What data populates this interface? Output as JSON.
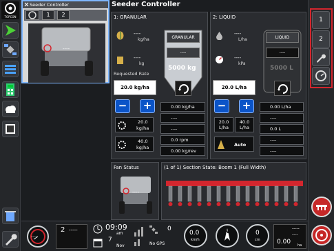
{
  "header": {
    "title": "Seeder Controller",
    "brand": "TOPCON"
  },
  "mini_view": {
    "title": "Seeder Controller",
    "tab_1": "1",
    "tab_2": "2",
    "machine_value": "----"
  },
  "granular": {
    "title": "1: GRANULAR",
    "rate_value": "----",
    "rate_unit": "kg/ha",
    "weight_value": "----",
    "weight_unit": "kg",
    "requested_label": "Requested Rate",
    "requested_rate": "20.0 kg/ha",
    "hopper_label": "GRANULAR",
    "hopper_value": "----",
    "hopper_capacity": "5000 kg",
    "preset_1_value": "20.0",
    "preset_1_unit": "kg/ha",
    "preset_2_value": "40.0",
    "preset_2_unit": "kg/ha",
    "stat_1": "0.00 kg/ha",
    "stat_2": "----",
    "stat_3": "----",
    "stat_4": "0.0 rpm",
    "stat_5": "0.00 kg/rev"
  },
  "liquid": {
    "title": "2: LIQUID",
    "rate_value": "----",
    "rate_unit": "L/ha",
    "pressure_value": "----",
    "pressure_unit": "kPa",
    "requested_rate": "20.0 L/ha",
    "tank_label": "LIQUID",
    "tank_value": "----",
    "tank_capacity": "5000 L",
    "preset_1_value": "20.0",
    "preset_1_unit": "L/ha",
    "preset_2_value": "40.0",
    "preset_2_unit": "L/ha",
    "auto_label": "Auto",
    "stat_1": "0.00 L/ha",
    "stat_2": "----",
    "stat_3": "0.0 L",
    "stat_4": "----",
    "stat_5": "----"
  },
  "fan": {
    "title": "Fan Status",
    "value": "----"
  },
  "section_state": {
    "title": "(1 of 1) Section State: Boom 1 (Full Width)"
  },
  "right_bar": {
    "btn_1": "1",
    "btn_2": "2"
  },
  "bottom": {
    "gauge_1_label": "----",
    "count_value": "2",
    "count_dash": "-----",
    "time": "09:09",
    "time_period": "am",
    "date_day": "7",
    "date_month": "Nov",
    "gps_value": "0",
    "gps_status": "No GPS",
    "gauge_2_value": "0.0",
    "gauge_2_unit": "km/h",
    "compass": "N",
    "gauge_3_value": "0",
    "gauge_3_unit": "cm",
    "gauge_4_value": "0.00",
    "gauge_4_unit": "ha",
    "dash_1": "-----",
    "dash_2": "----"
  },
  "colors": {
    "accent_blue": "#0b54c8",
    "highlight_red": "#d3262e",
    "frame_blue": "#7fb7ff"
  }
}
